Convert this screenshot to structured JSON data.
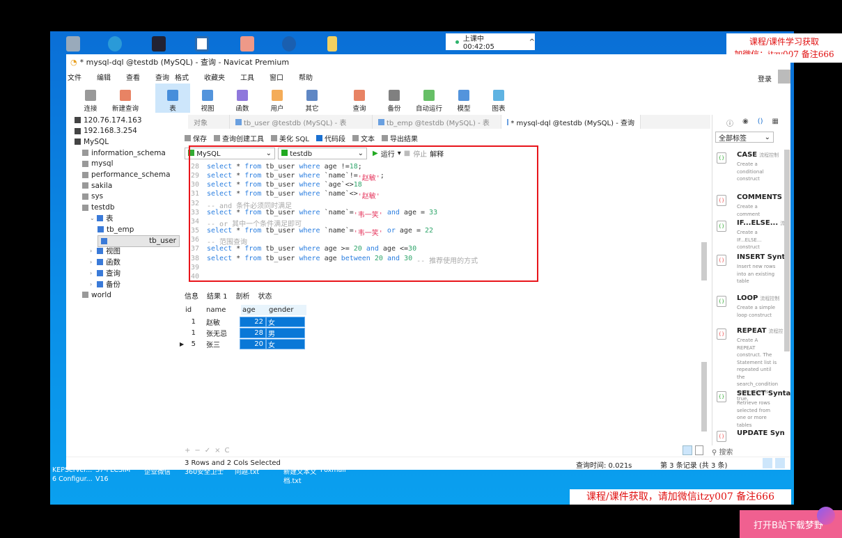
{
  "clock": {
    "label": "上课中 00:42:05",
    "caret": "^"
  },
  "watermark_top": [
    "课程/课件学习获取",
    "加微信：itzy007 备注666"
  ],
  "watermark_bottom": "课程/课件获取，请加微信itzy007 备注666",
  "pink_bubble": "打开B站下载梦野",
  "window": {
    "title": "* mysql-dql @testdb (MySQL) - 查询 - Navicat Premium",
    "login": "登录"
  },
  "menu": [
    "文件",
    "编辑",
    "查看",
    "查询",
    "格式",
    "收藏夹",
    "工具",
    "窗口",
    "帮助"
  ],
  "toolbar": [
    {
      "label": "连接",
      "icon": "connect-icon"
    },
    {
      "label": "新建查询",
      "icon": "new-query-icon"
    },
    {
      "label": "表",
      "icon": "table-icon",
      "active": true
    },
    {
      "label": "视图",
      "icon": "view-icon"
    },
    {
      "label": "函数",
      "icon": "function-icon"
    },
    {
      "label": "用户",
      "icon": "user-icon"
    },
    {
      "label": "其它",
      "icon": "other-icon"
    },
    {
      "label": "查询",
      "icon": "query-icon"
    },
    {
      "label": "备份",
      "icon": "backup-icon"
    },
    {
      "label": "自动运行",
      "icon": "schedule-icon"
    },
    {
      "label": "模型",
      "icon": "model-icon"
    },
    {
      "label": "图表",
      "icon": "chart-icon"
    }
  ],
  "tree": [
    {
      "label": "120.76.174.163",
      "level": 0
    },
    {
      "label": "192.168.3.254",
      "level": 0
    },
    {
      "label": "MySQL",
      "level": 0,
      "expanded": true
    },
    {
      "label": "information_schema",
      "level": 1
    },
    {
      "label": "mysql",
      "level": 1
    },
    {
      "label": "performance_schema",
      "level": 1
    },
    {
      "label": "sakila",
      "level": 1
    },
    {
      "label": "sys",
      "level": 1
    },
    {
      "label": "testdb",
      "level": 1,
      "expanded": true
    },
    {
      "label": "表",
      "level": 2,
      "expanded": true
    },
    {
      "label": "tb_emp",
      "level": 3
    },
    {
      "label": "tb_user",
      "level": 3,
      "selected": true
    },
    {
      "label": "视图",
      "level": 2
    },
    {
      "label": "函数",
      "level": 2
    },
    {
      "label": "查询",
      "level": 2
    },
    {
      "label": "备份",
      "level": 2
    },
    {
      "label": "world",
      "level": 1
    }
  ],
  "tabs": [
    {
      "label": "对象"
    },
    {
      "label": "tb_user @testdb (MySQL) - 表"
    },
    {
      "label": "tb_emp @testdb (MySQL) - 表"
    },
    {
      "label": "* mysql-dql @testdb (MySQL) - 查询",
      "active": true
    }
  ],
  "query_toolbar": [
    "保存",
    "查询创建工具",
    "美化 SQL",
    "代码段",
    "文本",
    "导出结果"
  ],
  "connection": "MySQL",
  "database": "testdb",
  "run": "运行",
  "stop": "停止",
  "explain": "解释",
  "editor_lines": [
    {
      "n": "28",
      "t": [
        [
          "kw",
          "select"
        ],
        [
          "tx",
          " * "
        ],
        [
          "kw",
          "from"
        ],
        [
          "tx",
          " tb_user "
        ],
        [
          "kw",
          "where"
        ],
        [
          "tx",
          " age !="
        ],
        [
          "num",
          "18"
        ],
        [
          "tx",
          ";"
        ]
      ]
    },
    {
      "n": "29",
      "t": [
        [
          "kw",
          "select"
        ],
        [
          "tx",
          " * "
        ],
        [
          "kw",
          "from"
        ],
        [
          "tx",
          " tb_user "
        ],
        [
          "kw",
          "where"
        ],
        [
          "tx",
          " `name`!="
        ],
        [
          "str",
          "'赵敏'"
        ],
        [
          "tx",
          ";"
        ]
      ]
    },
    {
      "n": "30",
      "t": [
        [
          "kw",
          "select"
        ],
        [
          "tx",
          " * "
        ],
        [
          "kw",
          "from"
        ],
        [
          "tx",
          " tb_user "
        ],
        [
          "kw",
          "where"
        ],
        [
          "tx",
          " `age`<>"
        ],
        [
          "num",
          "18"
        ]
      ]
    },
    {
      "n": "31",
      "t": [
        [
          "kw",
          "select"
        ],
        [
          "tx",
          " * "
        ],
        [
          "kw",
          "from"
        ],
        [
          "tx",
          " tb_user "
        ],
        [
          "kw",
          "where"
        ],
        [
          "tx",
          " `name`<>"
        ],
        [
          "str",
          "'赵敏'"
        ]
      ]
    },
    {
      "n": "32",
      "t": [
        [
          "cm",
          "-- and 条件必须同时满足"
        ]
      ]
    },
    {
      "n": "33",
      "t": [
        [
          "kw",
          "select"
        ],
        [
          "tx",
          " * "
        ],
        [
          "kw",
          "from"
        ],
        [
          "tx",
          " tb_user "
        ],
        [
          "kw",
          "where"
        ],
        [
          "tx",
          " `name`="
        ],
        [
          "str",
          "'韦一笑'"
        ],
        [
          "tx",
          " "
        ],
        [
          "kw",
          "and"
        ],
        [
          "tx",
          " age = "
        ],
        [
          "num",
          "33"
        ]
      ]
    },
    {
      "n": "34",
      "t": [
        [
          "cm",
          "-- or 其中一个条件满足即可"
        ]
      ]
    },
    {
      "n": "35",
      "t": [
        [
          "kw",
          "select"
        ],
        [
          "tx",
          " * "
        ],
        [
          "kw",
          "from"
        ],
        [
          "tx",
          " tb_user "
        ],
        [
          "kw",
          "where"
        ],
        [
          "tx",
          " `name`="
        ],
        [
          "str",
          "'韦一笑'"
        ],
        [
          "tx",
          " "
        ],
        [
          "kw",
          "or"
        ],
        [
          "tx",
          " age = "
        ],
        [
          "num",
          "22"
        ]
      ]
    },
    {
      "n": "36",
      "t": [
        [
          "cm",
          "-- 范围查询"
        ]
      ]
    },
    {
      "n": "37",
      "t": [
        [
          "kw",
          "select"
        ],
        [
          "tx",
          " * "
        ],
        [
          "kw",
          "from"
        ],
        [
          "tx",
          " tb_user "
        ],
        [
          "kw",
          "where"
        ],
        [
          "tx",
          " age >= "
        ],
        [
          "num",
          "20"
        ],
        [
          "tx",
          " "
        ],
        [
          "kw",
          "and"
        ],
        [
          "tx",
          " age <="
        ],
        [
          "num",
          "30"
        ]
      ]
    },
    {
      "n": "38",
      "t": [
        [
          "kw",
          "select"
        ],
        [
          "tx",
          " * "
        ],
        [
          "kw",
          "from"
        ],
        [
          "tx",
          " tb_user "
        ],
        [
          "kw",
          "where"
        ],
        [
          "tx",
          " age "
        ],
        [
          "kw",
          "between"
        ],
        [
          "tx",
          " "
        ],
        [
          "num",
          "20"
        ],
        [
          "tx",
          " "
        ],
        [
          "kw",
          "and"
        ],
        [
          "tx",
          " "
        ],
        [
          "num",
          "30"
        ],
        [
          "cm",
          " -- 推荐使用的方式"
        ]
      ]
    },
    {
      "n": "39",
      "t": []
    },
    {
      "n": "40",
      "t": []
    }
  ],
  "result_tabs": [
    "信息",
    "结果 1",
    "剖析",
    "状态"
  ],
  "result": {
    "columns": [
      "id",
      "name",
      "age",
      "gender"
    ],
    "rows": [
      [
        "1",
        "赵敏",
        "22",
        "女"
      ],
      [
        "1",
        "张无忌",
        "28",
        "男"
      ],
      [
        "5",
        "张三",
        "20",
        "女"
      ]
    ]
  },
  "snippets_filter": "全部标签",
  "snippets": [
    {
      "title": "CASE",
      "tag": "流程控制",
      "desc": "Create a conditional construct"
    },
    {
      "title": "COMMENTS",
      "tag": "",
      "desc": "Create a comment"
    },
    {
      "title": "IF...ELSE...",
      "tag": "流程",
      "desc": "Create a IF...ELSE... construct"
    },
    {
      "title": "INSERT Synta",
      "tag": "",
      "desc": "Insert new rows into an existing table"
    },
    {
      "title": "LOOP",
      "tag": "流程控制",
      "desc": "Create a simple loop construct"
    },
    {
      "title": "REPEAT",
      "tag": "流程控",
      "desc": "Create A REPEAT construct. The Statement list is repeated until the search_condition expression is true."
    },
    {
      "title": "SELECT Synta",
      "tag": "",
      "desc": "Retrieve rows selected from one or more tables"
    },
    {
      "title": "UPDATE Syn",
      "tag": "",
      "desc": ""
    }
  ],
  "search": "搜索",
  "status": {
    "selection": "3 Rows and 2 Cols Selected",
    "query_time": "查询时间: 0.021s",
    "record": "第 3 条记录 (共 3 条)"
  },
  "desktop_icons": [
    [
      "KEPServer...",
      "6 Configur..."
    ],
    [
      "S7-PLCSIM",
      "V16"
    ],
    [
      "企业微信",
      ""
    ],
    [
      "360安全卫士",
      ""
    ],
    [
      "问题.txt",
      ""
    ],
    [
      "新建文本文",
      "档.txt"
    ],
    [
      "Foxmail",
      ""
    ]
  ]
}
